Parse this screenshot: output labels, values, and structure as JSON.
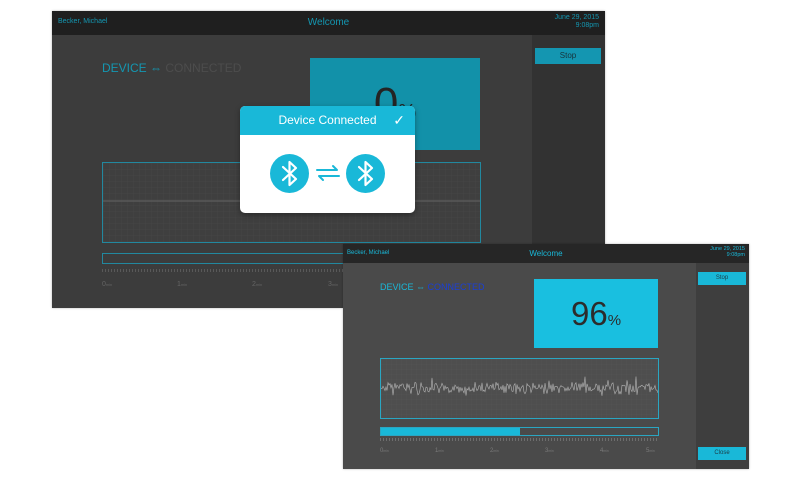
{
  "screen_back": {
    "header": {
      "user": "Becker, Michael",
      "title": "Welcome",
      "date": "June 29, 2015",
      "time": "9:08pm"
    },
    "device_label": "DEVICE",
    "device_status": "CONNECTED",
    "percent": "0",
    "percent_unit": "%",
    "stop_label": "Stop",
    "time_ticks": [
      "0",
      "1",
      "2",
      "3"
    ],
    "time_unit": "min",
    "dialog": {
      "title": "Device Connected",
      "left_icon": "bluetooth-icon",
      "right_icon": "bluetooth-icon",
      "check_icon": "checkmark-icon"
    }
  },
  "screen_front": {
    "header": {
      "user": "Becker, Michael",
      "title": "Welcome",
      "date": "June 29, 2015",
      "time": "9:08pm"
    },
    "device_label": "DEVICE",
    "device_status": "CONNECTED",
    "percent": "96",
    "percent_unit": "%",
    "progress": 0.5,
    "stop_label": "Stop",
    "close_label": "Close",
    "time_ticks": [
      "0",
      "1",
      "2",
      "3",
      "4",
      "5"
    ],
    "time_unit": "min"
  },
  "colors": {
    "accent": "#19b8d8",
    "screen_bg": "#4a4a4a",
    "header_bg": "#262626",
    "status_connected": "#1a3fd6"
  }
}
